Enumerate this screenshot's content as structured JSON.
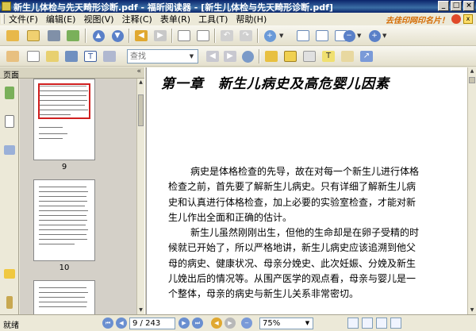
{
  "window": {
    "title": "新生儿体检与先天畸形诊断.pdf - 福昕阅读器 - [新生儿体检与先天畸形诊断.pdf]",
    "minimize_glyph": "_",
    "maximize_glyph": "□",
    "close_glyph": "×"
  },
  "menu": {
    "items": [
      "文件(F)",
      "编辑(E)",
      "视图(V)",
      "注释(C)",
      "表单(R)",
      "工具(T)",
      "帮助(H)"
    ],
    "ad_text": "去佳印网印名片！"
  },
  "toolbar2": {
    "search_placeholder": "查找"
  },
  "left_panel": {
    "title": "页面",
    "thumbnails": [
      {
        "caption": "9"
      },
      {
        "caption": "10"
      }
    ]
  },
  "document": {
    "heading": "第一章　新生儿病史及高危婴儿因素",
    "paragraph1": [
      "病史是体格检查的先导，故在对每一个新生儿进行体格",
      "检查之前，首先要了解新生儿病史。只有详细了解新生儿病",
      "史和认真进行体格检查，加上必要的实验室检查，才能对新",
      "生儿作出全面和正确的估计。"
    ],
    "paragraph2": [
      "新生儿虽然刚刚出生，但他的生命却是在卵子受精的时",
      "候就已开始了，所以严格地讲，新生儿病史应该追溯到他父",
      "母的病史、健康状况、母亲分娩史、此次妊娠、分娩及新生",
      "儿娩出后的情况等。从围产医学的观点看，母亲与婴儿是一",
      "个整体，母亲的病史与新生儿关系非常密切。"
    ]
  },
  "status": {
    "text": "就绪",
    "page_indicator": "9 / 243",
    "zoom": "75%"
  }
}
